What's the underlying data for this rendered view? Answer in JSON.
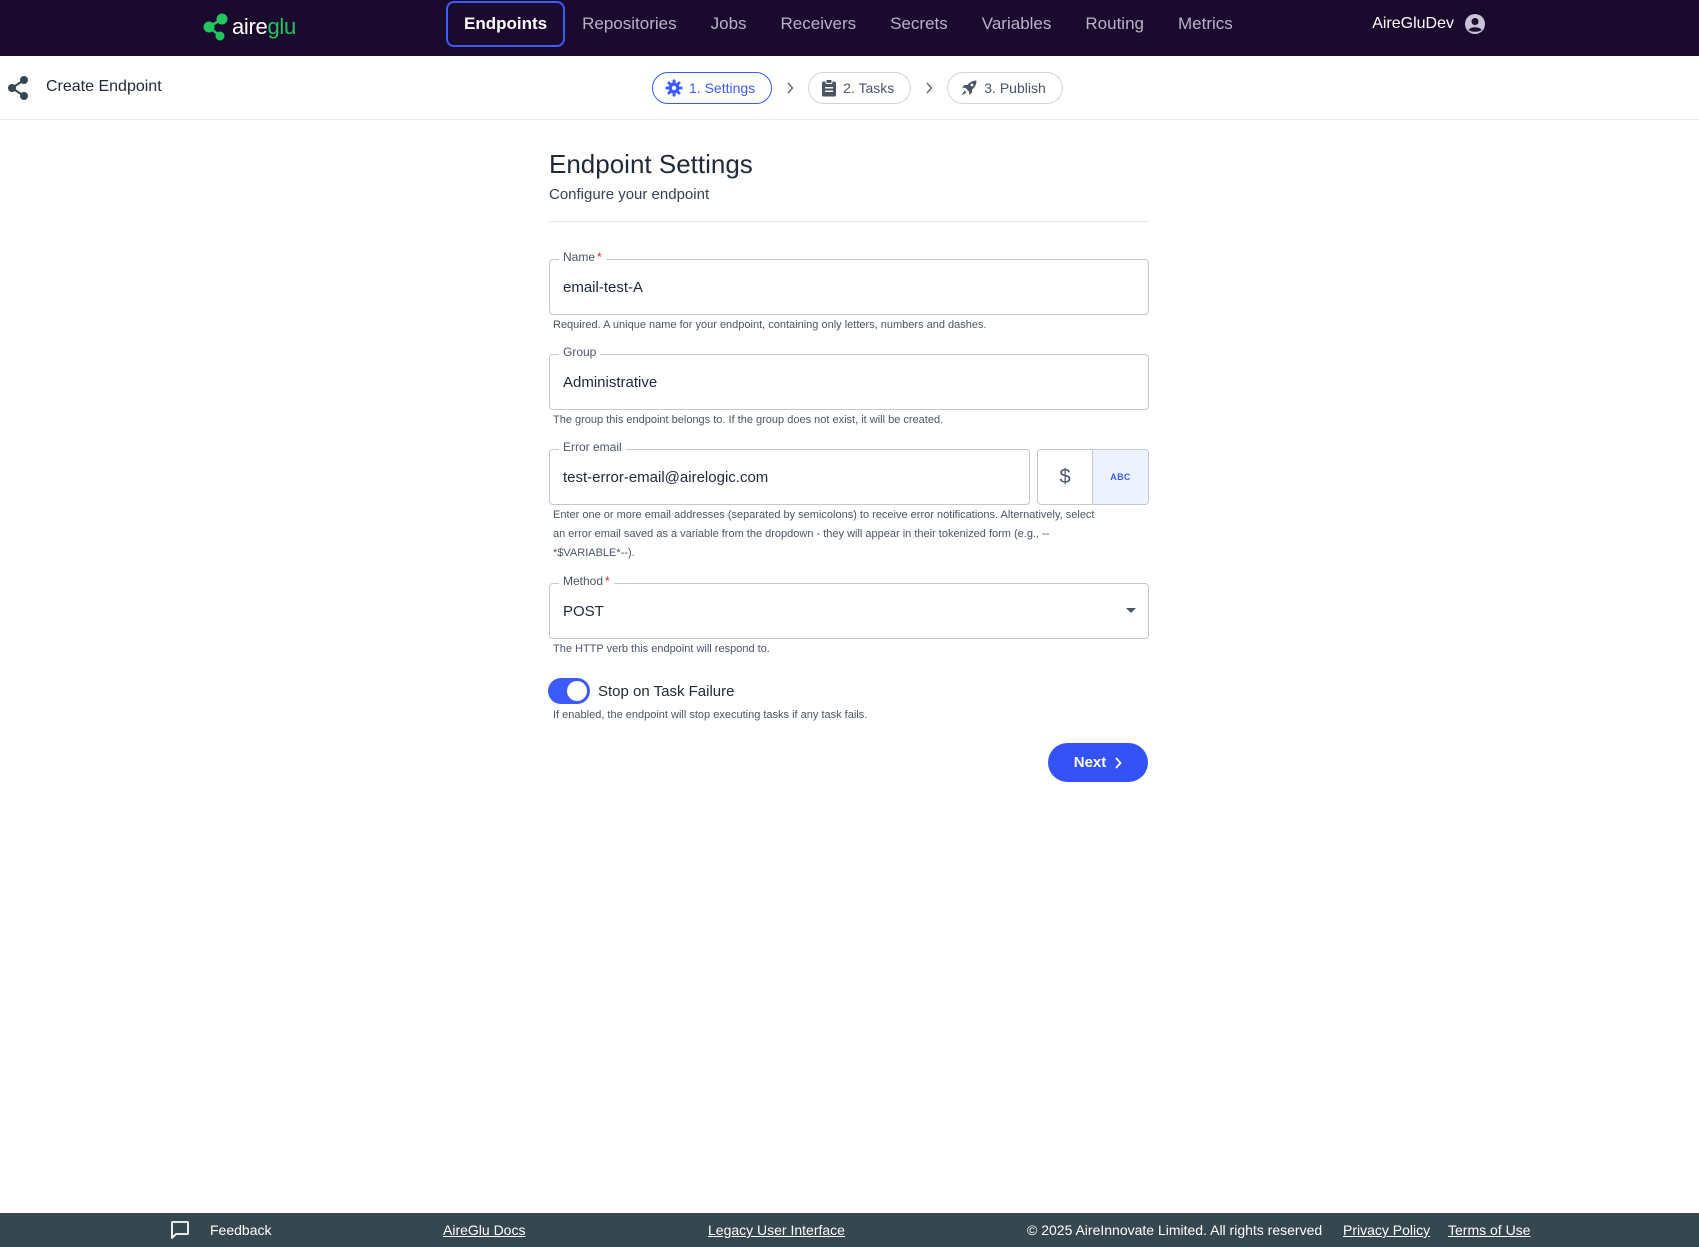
{
  "brand": {
    "logo_prefix": "aire",
    "logo_suffix": "glu",
    "accent": "#3b5bfd",
    "logo_green": "#22c55e",
    "nav_bg": "#1a0a2e"
  },
  "nav": {
    "items": [
      {
        "label": "Endpoints",
        "active": true
      },
      {
        "label": "Repositories"
      },
      {
        "label": "Jobs"
      },
      {
        "label": "Receivers"
      },
      {
        "label": "Secrets"
      },
      {
        "label": "Variables"
      },
      {
        "label": "Routing"
      },
      {
        "label": "Metrics"
      }
    ],
    "user": {
      "name": "AireGluDev",
      "icon": "account-circle-icon"
    }
  },
  "subheader": {
    "icon": "share-icon",
    "title": "Create Endpoint",
    "steps": [
      {
        "label": "1. Settings",
        "icon": "gear-icon",
        "active": true
      },
      {
        "label": "2. Tasks",
        "icon": "clipboard-icon"
      },
      {
        "label": "3. Publish",
        "icon": "rocket-icon"
      }
    ]
  },
  "form": {
    "title": "Endpoint Settings",
    "subtitle": "Configure your endpoint",
    "name": {
      "label": "Name",
      "required_mark": "*",
      "value": "email-test-A",
      "helper": "Required. A unique name for your endpoint, containing only letters, numbers and dashes."
    },
    "group": {
      "label": "Group",
      "value": "Administrative",
      "helper": "The group this endpoint belongs to. If the group does not exist, it will be created."
    },
    "error_email": {
      "label": "Error email",
      "value": "test-error-email@airelogic.com",
      "helper_line1": "Enter one or more email addresses (separated by semicolons) to receive error notifications. Alternatively, select",
      "helper_line2": "an error email saved as a variable from the dropdown - they will appear in their tokenized form (e.g., --",
      "helper_line3": "*$VARIABLE*--).",
      "toggle_variable": "$",
      "toggle_text": "ABC"
    },
    "method": {
      "label": "Method",
      "required_mark": "*",
      "value": "POST",
      "helper": "The HTTP verb this endpoint will respond to."
    },
    "stop_on_failure": {
      "label": "Stop on Task Failure",
      "enabled": true,
      "helper": "If enabled, the endpoint will stop executing tasks if any task fails."
    },
    "next_label": "Next"
  },
  "footer": {
    "feedback": "Feedback",
    "docs": "AireGlu Docs",
    "legacy": "Legacy User Interface",
    "copyright": "© 2025 AireInnovate Limited. All rights reserved",
    "privacy": "Privacy Policy",
    "terms": "Terms of Use"
  }
}
